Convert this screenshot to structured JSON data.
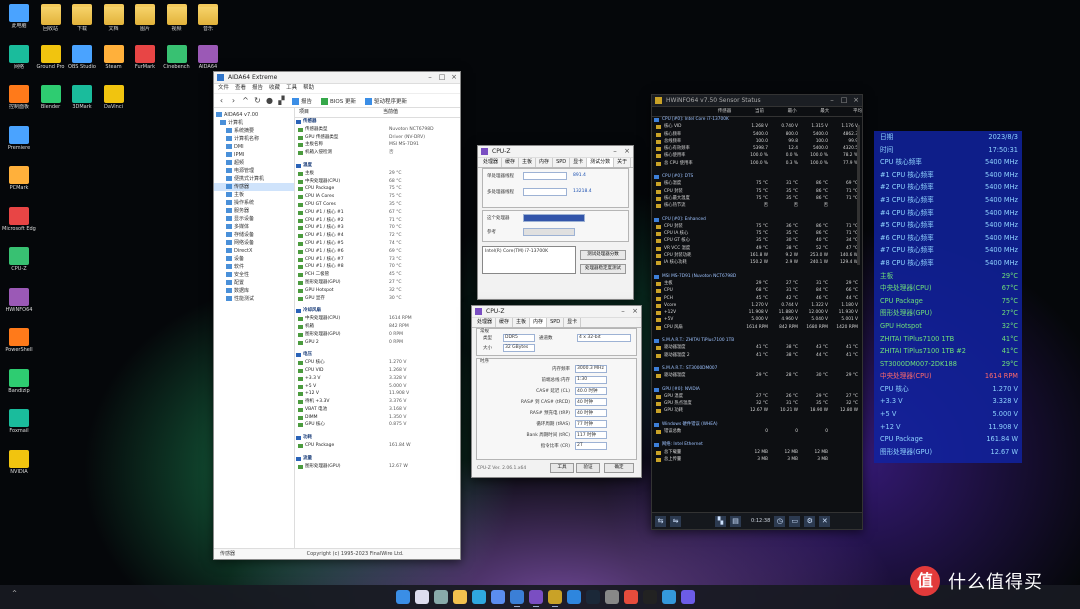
{
  "desktop": {
    "icons": [
      {
        "label": "此电脑",
        "kind": "pc"
      },
      {
        "label": "回收站",
        "kind": "folder"
      },
      {
        "label": "下载",
        "kind": "folder"
      },
      {
        "label": "文档",
        "kind": "folder"
      },
      {
        "label": "图片",
        "kind": "folder"
      },
      {
        "label": "视频",
        "kind": "folder"
      },
      {
        "label": "音乐",
        "kind": "folder"
      },
      {
        "label": "网络",
        "kind": "pc"
      },
      {
        "label": "Ground Pro",
        "kind": "app"
      },
      {
        "label": "OBS Studio",
        "kind": "app"
      },
      {
        "label": "Steam",
        "kind": "app"
      },
      {
        "label": "FurMark",
        "kind": "app"
      },
      {
        "label": "Cinebench",
        "kind": "app"
      },
      {
        "label": "AIDA64",
        "kind": "app"
      },
      {
        "label": "控制面板",
        "kind": "app"
      },
      {
        "label": "Blender",
        "kind": "app"
      },
      {
        "label": "3DMark",
        "kind": "app"
      },
      {
        "label": "DaVinci",
        "kind": "app"
      },
      {
        "label": "Premiere",
        "kind": "app"
      },
      {
        "label": "PCMark",
        "kind": "app"
      },
      {
        "label": "Microsoft Edge",
        "kind": "app"
      },
      {
        "label": "CPU-Z",
        "kind": "app"
      },
      {
        "label": "HWiNFO64",
        "kind": "app"
      },
      {
        "label": "PowerShell",
        "kind": "app"
      },
      {
        "label": "Bandizip",
        "kind": "app"
      },
      {
        "label": "Foxmail",
        "kind": "app"
      },
      {
        "label": "NVIDIA",
        "kind": "app"
      }
    ]
  },
  "aida": {
    "title": "AIDA64 Extreme",
    "menu": [
      "文件",
      "查看",
      "报告",
      "收藏",
      "工具",
      "帮助"
    ],
    "toolbar": {
      "report": "报告",
      "bios": "BIOS 更新",
      "driver": "驱动程序更新"
    },
    "tree": [
      {
        "label": "AIDA64 v7.00",
        "selected": false
      },
      {
        "label": "计算机",
        "selected": false
      },
      {
        "label": "系统摘要",
        "selected": false
      },
      {
        "label": "计算机名称",
        "selected": false
      },
      {
        "label": "DMI",
        "selected": false
      },
      {
        "label": "IPMI",
        "selected": false
      },
      {
        "label": "超频",
        "selected": false
      },
      {
        "label": "电源管理",
        "selected": false
      },
      {
        "label": "便携式计算机",
        "selected": false
      },
      {
        "label": "传感器",
        "selected": true
      },
      {
        "label": "主板",
        "selected": false
      },
      {
        "label": "操作系统",
        "selected": false
      },
      {
        "label": "服务器",
        "selected": false
      },
      {
        "label": "显示设备",
        "selected": false
      },
      {
        "label": "多媒体",
        "selected": false
      },
      {
        "label": "存储设备",
        "selected": false
      },
      {
        "label": "网络设备",
        "selected": false
      },
      {
        "label": "DirectX",
        "selected": false
      },
      {
        "label": "设备",
        "selected": false
      },
      {
        "label": "软件",
        "selected": false
      },
      {
        "label": "安全性",
        "selected": false
      },
      {
        "label": "配置",
        "selected": false
      },
      {
        "label": "数据库",
        "selected": false
      },
      {
        "label": "性能测试",
        "selected": false
      }
    ],
    "columns": [
      "项目",
      "当前值"
    ],
    "rows": [
      {
        "f": "传感器",
        "v": "",
        "section": true
      },
      {
        "f": "传感器类型",
        "v": "Nuvoton NCT6798D",
        "section": false
      },
      {
        "f": "GPU 传感器类型",
        "v": "Driver (NV-DRV)",
        "section": false
      },
      {
        "f": "主板名称",
        "v": "MSI MS-7D91",
        "section": false
      },
      {
        "f": "机箱入侵检测",
        "v": "否",
        "section": false
      },
      {
        "f": "",
        "v": "",
        "blank": true
      },
      {
        "f": "温度",
        "v": "",
        "section": true
      },
      {
        "f": "主板",
        "v": "29 °C",
        "section": false
      },
      {
        "f": "中央处理器(CPU)",
        "v": "68 °C",
        "section": false
      },
      {
        "f": "CPU Package",
        "v": "75 °C",
        "section": false
      },
      {
        "f": "CPU IA Cores",
        "v": "75 °C",
        "section": false
      },
      {
        "f": "CPU GT Cores",
        "v": "35 °C",
        "section": false
      },
      {
        "f": "CPU #1 / 核心 #1",
        "v": "67 °C",
        "section": false
      },
      {
        "f": "CPU #1 / 核心 #2",
        "v": "71 °C",
        "section": false
      },
      {
        "f": "CPU #1 / 核心 #3",
        "v": "70 °C",
        "section": false
      },
      {
        "f": "CPU #1 / 核心 #4",
        "v": "72 °C",
        "section": false
      },
      {
        "f": "CPU #1 / 核心 #5",
        "v": "74 °C",
        "section": false
      },
      {
        "f": "CPU #1 / 核心 #6",
        "v": "69 °C",
        "section": false
      },
      {
        "f": "CPU #1 / 核心 #7",
        "v": "73 °C",
        "section": false
      },
      {
        "f": "CPU #1 / 核心 #8",
        "v": "70 °C",
        "section": false
      },
      {
        "f": "PCH 二极管",
        "v": "45 °C",
        "section": false
      },
      {
        "f": "图形处理器(GPU)",
        "v": "27 °C",
        "section": false
      },
      {
        "f": "GPU Hotspot",
        "v": "32 °C",
        "section": false
      },
      {
        "f": "GPU 显存",
        "v": "30 °C",
        "section": false
      },
      {
        "f": "",
        "v": "",
        "blank": true
      },
      {
        "f": "冷却风扇",
        "v": "",
        "section": true
      },
      {
        "f": "中央处理器(CPU)",
        "v": "1614 RPM",
        "section": false
      },
      {
        "f": "机箱",
        "v": "842 RPM",
        "section": false
      },
      {
        "f": "图形处理器(GPU)",
        "v": "0 RPM",
        "section": false
      },
      {
        "f": "GPU 2",
        "v": "0 RPM",
        "section": false
      },
      {
        "f": "",
        "v": "",
        "blank": true
      },
      {
        "f": "电压",
        "v": "",
        "section": true
      },
      {
        "f": "CPU 核心",
        "v": "1.270 V",
        "section": false
      },
      {
        "f": "CPU VID",
        "v": "1.268 V",
        "section": false
      },
      {
        "f": "+3.3 V",
        "v": "3.328 V",
        "section": false
      },
      {
        "f": "+5 V",
        "v": "5.000 V",
        "section": false
      },
      {
        "f": "+12 V",
        "v": "11.908 V",
        "section": false
      },
      {
        "f": "待机 +3.3V",
        "v": "3.376 V",
        "section": false
      },
      {
        "f": "VBAT 电池",
        "v": "3.168 V",
        "section": false
      },
      {
        "f": "DIMM",
        "v": "1.350 V",
        "section": false
      },
      {
        "f": "GPU 核心",
        "v": "0.875 V",
        "section": false
      },
      {
        "f": "",
        "v": "",
        "blank": true
      },
      {
        "f": "功耗",
        "v": "",
        "section": true
      },
      {
        "f": "CPU Package",
        "v": "161.84 W",
        "section": false
      },
      {
        "f": "",
        "v": "",
        "blank": true
      },
      {
        "f": "流量",
        "v": "",
        "section": true
      },
      {
        "f": "图形处理器(GPU)",
        "v": "12.67 W",
        "section": false
      }
    ],
    "status_left": "传感器",
    "status_right": "Copyright (c) 1995-2023 FinalWire Ltd."
  },
  "cpuz1": {
    "title": "CPU-Z",
    "tabs": [
      "处理器",
      "缓存",
      "主板",
      "内存",
      "SPD",
      "显卡",
      "测试分数",
      "关于"
    ],
    "active_tab": "测试分数",
    "single_label": "单处理器线程",
    "multi_label": "多处理器线程",
    "single_value": "891.4",
    "multi_value": "13218.4",
    "reference_label": "参考",
    "bench_button": "测试处理器分数",
    "stress_button": "处理器稳定度测试",
    "this_processor": "这个处理器",
    "reference_value": "Intel(R) Core(TM) i7-13700K"
  },
  "cpuz2": {
    "title": "CPU-Z",
    "tabs": [
      "处理器",
      "缓存",
      "主板",
      "内存",
      "SPD",
      "显卡"
    ],
    "active_tab": "内存",
    "general_label": "常规",
    "type_label": "类型",
    "type_value": "DDR5",
    "size_label": "大小",
    "size_value": "32 GBytes",
    "channels_label": "通道数",
    "channels_value": "4 x 32-bit",
    "timings_label": "时序",
    "dram_freq_label": "内存频率",
    "dram_freq_value": "3000.3 MHz",
    "fsb_label": "前端总线:内存",
    "fsb_value": "1:30",
    "cl_label": "CAS# 延迟 (CL)",
    "cl_value": "40.0 时钟",
    "trcd_label": "RAS# 到 CAS# (tRCD)",
    "trcd_value": "40 时钟",
    "trp_label": "RAS# 预充电 (tRP)",
    "trp_value": "40 时钟",
    "tras_label": "循环周期 (tRAS)",
    "tras_value": "77 时钟",
    "trc_label": "Bank 周期时间 (tRC)",
    "trc_value": "117 时钟",
    "cr_label": "指令比率 (CR)",
    "cr_value": "2T",
    "version": "CPU-Z Ver. 2.06.1.x64",
    "tools_button": "工具",
    "verify_button": "验证",
    "ok_button": "确定"
  },
  "hwinfo": {
    "title": "HWiNFO64 v7.50 Sensor Status",
    "columns": [
      "传感器",
      "当前",
      "最小",
      "最大",
      "平均"
    ],
    "rows": [
      {
        "n": "CPU [#0]: Intel Core i7-13700K",
        "g": true
      },
      {
        "n": "核心 VID",
        "c": "1.268 V",
        "mi": "0.740 V",
        "ma": "1.315 V",
        "av": "1.176 V"
      },
      {
        "n": "核心频率",
        "c": "5400.0",
        "mi": "800.0",
        "ma": "5400.0",
        "av": "4862.3"
      },
      {
        "n": "总线频率",
        "c": "100.0",
        "mi": "99.8",
        "ma": "100.0",
        "av": "99.9"
      },
      {
        "n": "核心有效频率",
        "c": "5398.7",
        "mi": "12.4",
        "ma": "5400.0",
        "av": "4320.5"
      },
      {
        "n": "核心使用率",
        "c": "100.0 %",
        "mi": "0.0 %",
        "ma": "100.0 %",
        "av": "78.2 %"
      },
      {
        "n": "总 CPU 使用率",
        "c": "100.0 %",
        "mi": "0.3 %",
        "ma": "100.0 %",
        "av": "77.9 %"
      },
      {
        "n": "",
        "gap": true
      },
      {
        "n": "CPU [#0]: DTS",
        "g": true
      },
      {
        "n": "核心温度",
        "c": "75 °C",
        "mi": "31 °C",
        "ma": "86 °C",
        "av": "69 °C"
      },
      {
        "n": "CPU 封装",
        "c": "75 °C",
        "mi": "35 °C",
        "ma": "86 °C",
        "av": "71 °C"
      },
      {
        "n": "核心最大温度",
        "c": "75 °C",
        "mi": "35 °C",
        "ma": "86 °C",
        "av": "71 °C"
      },
      {
        "n": "核心热节流",
        "c": "否",
        "mi": "否",
        "ma": "否",
        "av": ""
      },
      {
        "n": "",
        "gap": true
      },
      {
        "n": "CPU [#0]: Enhanced",
        "g": true
      },
      {
        "n": "CPU 封装",
        "c": "75 °C",
        "mi": "36 °C",
        "ma": "86 °C",
        "av": "71 °C"
      },
      {
        "n": "CPU IA 核心",
        "c": "75 °C",
        "mi": "35 °C",
        "ma": "86 °C",
        "av": "71 °C"
      },
      {
        "n": "CPU GT 核心",
        "c": "35 °C",
        "mi": "30 °C",
        "ma": "40 °C",
        "av": "34 °C"
      },
      {
        "n": "VR VCC 温度",
        "c": "49 °C",
        "mi": "38 °C",
        "ma": "52 °C",
        "av": "47 °C"
      },
      {
        "n": "CPU 封装功耗",
        "c": "161.8 W",
        "mi": "9.2 W",
        "ma": "253.0 W",
        "av": "140.6 W"
      },
      {
        "n": "IA 核心功耗",
        "c": "150.2 W",
        "mi": "2.9 W",
        "ma": "240.1 W",
        "av": "129.4 W"
      },
      {
        "n": "",
        "gap": true
      },
      {
        "n": "MSI MS-7D91 (Nuvoton NCT6798D)",
        "g": true
      },
      {
        "n": "主板",
        "c": "29 °C",
        "mi": "27 °C",
        "ma": "31 °C",
        "av": "29 °C"
      },
      {
        "n": "CPU",
        "c": "68 °C",
        "mi": "31 °C",
        "ma": "84 °C",
        "av": "66 °C"
      },
      {
        "n": "PCH",
        "c": "45 °C",
        "mi": "42 °C",
        "ma": "46 °C",
        "av": "44 °C"
      },
      {
        "n": "Vcore",
        "c": "1.270 V",
        "mi": "0.744 V",
        "ma": "1.322 V",
        "av": "1.180 V"
      },
      {
        "n": "+12V",
        "c": "11.908 V",
        "mi": "11.880 V",
        "ma": "12.000 V",
        "av": "11.930 V"
      },
      {
        "n": "+5V",
        "c": "5.000 V",
        "mi": "4.960 V",
        "ma": "5.040 V",
        "av": "5.001 V"
      },
      {
        "n": "CPU 风扇",
        "c": "1614 RPM",
        "mi": "842 RPM",
        "ma": "1680 RPM",
        "av": "1420 RPM"
      },
      {
        "n": "",
        "gap": true
      },
      {
        "n": "S.M.A.R.T.: ZHITAI TiPlus7100 1TB",
        "g": true
      },
      {
        "n": "驱动器温度",
        "c": "41 °C",
        "mi": "38 °C",
        "ma": "43 °C",
        "av": "41 °C"
      },
      {
        "n": "驱动器温度 2",
        "c": "41 °C",
        "mi": "38 °C",
        "ma": "44 °C",
        "av": "41 °C"
      },
      {
        "n": "",
        "gap": true
      },
      {
        "n": "S.M.A.R.T.: ST3000DM007",
        "g": true
      },
      {
        "n": "驱动器温度",
        "c": "29 °C",
        "mi": "28 °C",
        "ma": "30 °C",
        "av": "29 °C"
      },
      {
        "n": "",
        "gap": true
      },
      {
        "n": "GPU [#0]: NVIDIA",
        "g": true
      },
      {
        "n": "GPU 温度",
        "c": "27 °C",
        "mi": "26 °C",
        "ma": "29 °C",
        "av": "27 °C"
      },
      {
        "n": "GPU 热点温度",
        "c": "32 °C",
        "mi": "31 °C",
        "ma": "35 °C",
        "av": "32 °C"
      },
      {
        "n": "GPU 功耗",
        "c": "12.67 W",
        "mi": "10.21 W",
        "ma": "18.90 W",
        "av": "12.80 W"
      },
      {
        "n": "",
        "gap": true
      },
      {
        "n": "Windows 硬件错误 (WHEA)",
        "g": true
      },
      {
        "n": "错误总数",
        "c": "0",
        "mi": "0",
        "ma": "0",
        "av": ""
      },
      {
        "n": "",
        "gap": true
      },
      {
        "n": "网络: Intel Ethernet",
        "g": true
      },
      {
        "n": "总下载量",
        "c": "12 MB",
        "mi": "12 MB",
        "ma": "12 MB",
        "av": ""
      },
      {
        "n": "总上传量",
        "c": "3 MB",
        "mi": "3 MB",
        "ma": "3 MB",
        "av": ""
      }
    ],
    "elapsed": "0:12:38"
  },
  "osd": {
    "rows": [
      {
        "name": "日期",
        "value": "2023/8/3",
        "color": "#8fd3ff"
      },
      {
        "name": "时间",
        "value": "17:50:31",
        "color": "#8fd3ff"
      },
      {
        "name": "CPU 核心频率",
        "value": "5400 MHz",
        "color": "#8fd3ff"
      },
      {
        "name": "#1 CPU 核心频率",
        "value": "5400 MHz",
        "color": "#8fd3ff"
      },
      {
        "name": "#2 CPU 核心频率",
        "value": "5400 MHz",
        "color": "#8fd3ff"
      },
      {
        "name": "#3 CPU 核心频率",
        "value": "5400 MHz",
        "color": "#8fd3ff"
      },
      {
        "name": "#4 CPU 核心频率",
        "value": "5400 MHz",
        "color": "#8fd3ff"
      },
      {
        "name": "#5 CPU 核心频率",
        "value": "5400 MHz",
        "color": "#8fd3ff"
      },
      {
        "name": "#6 CPU 核心频率",
        "value": "5400 MHz",
        "color": "#8fd3ff"
      },
      {
        "name": "#7 CPU 核心频率",
        "value": "5400 MHz",
        "color": "#8fd3ff"
      },
      {
        "name": "#8 CPU 核心频率",
        "value": "5400 MHz",
        "color": "#8fd3ff"
      },
      {
        "name": "主板",
        "value": "29°C",
        "color": "#6fe07a"
      },
      {
        "name": "中央处理器(CPU)",
        "value": "67°C",
        "color": "#6fe07a"
      },
      {
        "name": "CPU Package",
        "value": "75°C",
        "color": "#6fe07a"
      },
      {
        "name": "图形处理器(GPU)",
        "value": "27°C",
        "color": "#6fe07a"
      },
      {
        "name": "GPU Hotspot",
        "value": "32°C",
        "color": "#6fe07a"
      },
      {
        "name": "ZHITAI TiPlus7100 1TB",
        "value": "41°C",
        "color": "#6fe07a"
      },
      {
        "name": "ZHITAI TiPlus7100 1TB #2",
        "value": "41°C",
        "color": "#6fe07a"
      },
      {
        "name": "ST3000DM007-2DK188",
        "value": "29°C",
        "color": "#6fe07a"
      },
      {
        "name": "中央处理器(CPU)",
        "value": "1614 RPM",
        "color": "#ff6a6a"
      },
      {
        "name": "CPU 核心",
        "value": "1.270 V",
        "color": "#8fd3ff"
      },
      {
        "name": "+3.3 V",
        "value": "3.328 V",
        "color": "#8fd3ff"
      },
      {
        "name": "+5 V",
        "value": "5.000 V",
        "color": "#8fd3ff"
      },
      {
        "name": "+12 V",
        "value": "11.908 V",
        "color": "#8fd3ff"
      },
      {
        "name": "CPU Package",
        "value": "161.84 W",
        "color": "#8fd3ff"
      },
      {
        "name": "图形处理器(GPU)",
        "value": "12.67 W",
        "color": "#8fd3ff"
      }
    ]
  },
  "taskbar": {
    "tray": "^",
    "apps": [
      "start",
      "search",
      "task-view",
      "explorer",
      "edge",
      "store",
      "aida64",
      "cpu-z",
      "hwinfo",
      "mail",
      "steam",
      "settings",
      "chrome",
      "terminal",
      "photos",
      "ai"
    ]
  },
  "watermark": {
    "logo": "值",
    "text": "什么值得买"
  }
}
